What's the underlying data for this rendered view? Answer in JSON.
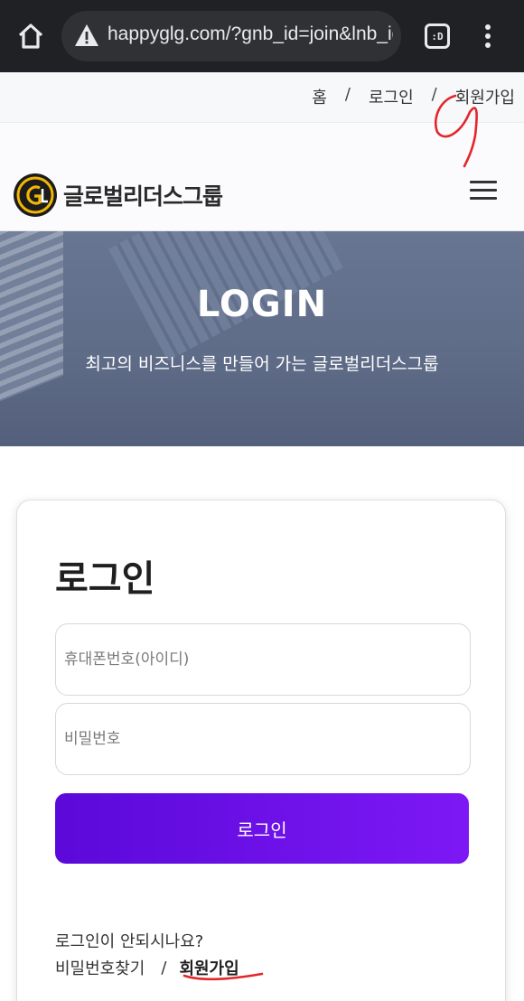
{
  "browser": {
    "url": "happyglg.com/?gnb_id=join&lnb_id",
    "tabs_label": ":D",
    "icons": [
      "home-icon",
      "warning-icon",
      "tab-switcher-icon",
      "more-vert-icon"
    ]
  },
  "breadcrumb": {
    "items": [
      "홈",
      "로그인",
      "회원가입"
    ],
    "separator": "/"
  },
  "header": {
    "logo_text": "글로벌리더스그룹",
    "icons": [
      "logo-mark-icon",
      "hamburger-menu-icon"
    ]
  },
  "hero": {
    "title": "LOGIN",
    "subtitle": "최고의 비즈니스를 만들어 가는 글로벌리더스그룹"
  },
  "login": {
    "heading": "로그인",
    "phone_placeholder": "휴대폰번호(아이디)",
    "password_placeholder": "비밀번호",
    "submit_label": "로그인",
    "help_text": "로그인이 안되시나요?",
    "find_password": "비밀번호찾기",
    "link_separator": "/",
    "join_label": "회원가입"
  },
  "colors": {
    "chrome_bg": "#202124",
    "button_start": "#5b09d9",
    "button_end": "#7d18f5",
    "annotation": "#e3262b"
  }
}
